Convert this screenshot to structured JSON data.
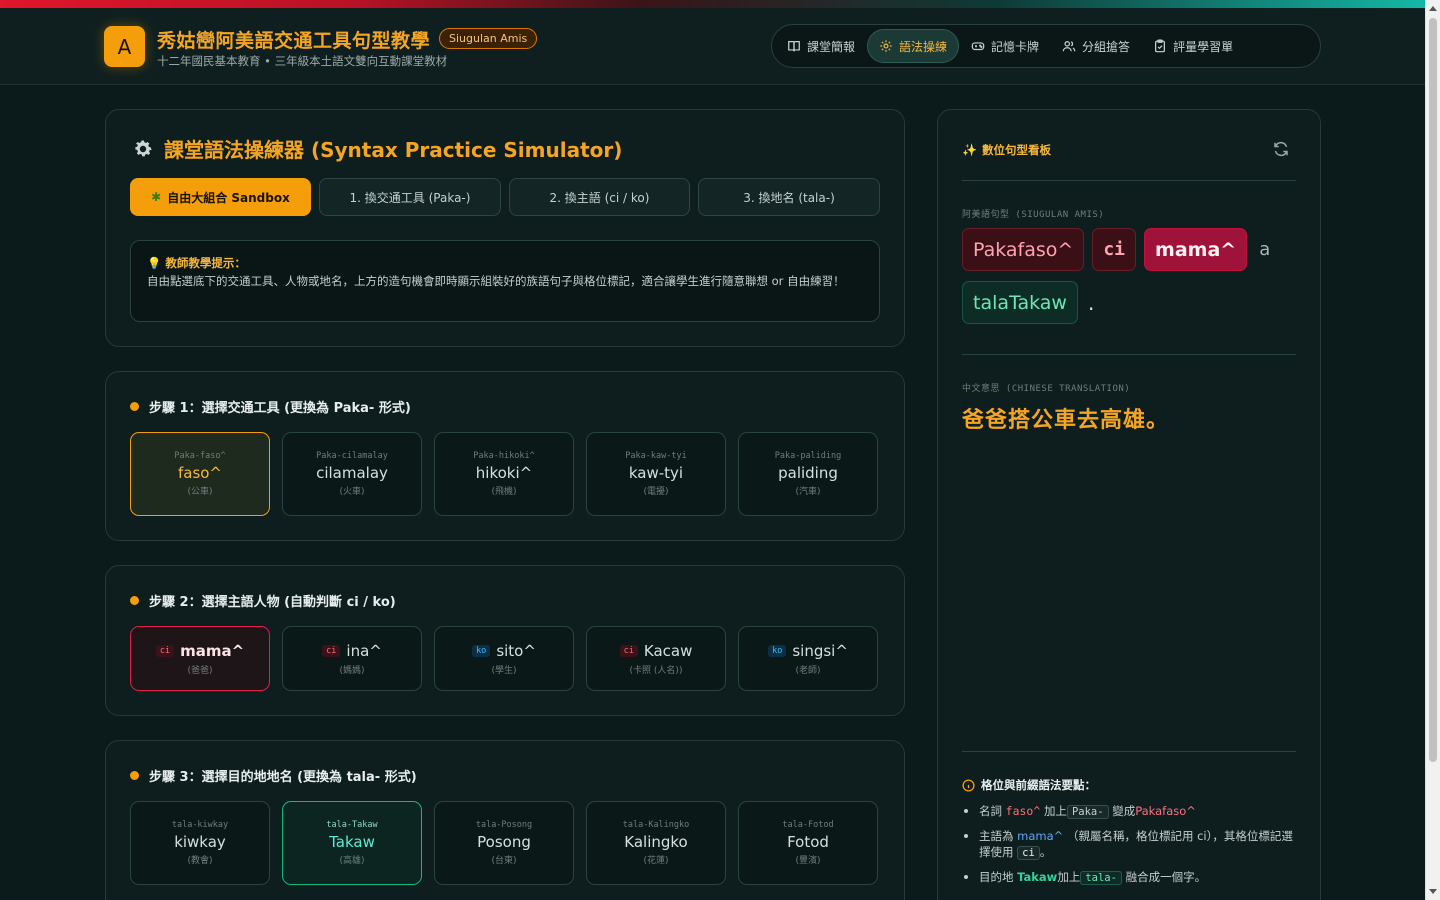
{
  "header": {
    "logo_letter": "A",
    "title": "秀姑巒阿美語交通工具句型教學",
    "badge": "Siugulan Amis",
    "subtitle": "十二年國民基本教育 • 三年級本土語文雙向互動課堂教材"
  },
  "nav": [
    {
      "label": "課堂簡報",
      "icon": "book-icon"
    },
    {
      "label": "語法操練",
      "icon": "gear-icon"
    },
    {
      "label": "記憶卡牌",
      "icon": "gamepad-icon"
    },
    {
      "label": "分組搶答",
      "icon": "users-icon"
    },
    {
      "label": "評量學習單",
      "icon": "clipboard-icon"
    }
  ],
  "nav_active": "語法操練",
  "simulator": {
    "title": "課堂語法操練器 (Syntax Practice Simulator)",
    "tabs": [
      "自由大組合 Sandbox",
      "1. 換交通工具 (Paka-)",
      "2. 換主語 (ci / ko)",
      "3. 換地名 (tala-)"
    ],
    "active_tab": "自由大組合 Sandbox",
    "hint_title": "教師教學提示：",
    "hint_body": "自由點選底下的交通工具、人物或地名，上方的造句機會即時顯示組裝好的族語句子與格位標記，適合讓學生進行隨意聯想 or 自由練習！"
  },
  "step1": {
    "title": "步驟 1：選擇交通工具 (更換為 Paka- 形式)",
    "items": [
      {
        "prefix": "Paka-faso^",
        "word": "faso^",
        "cn": "(公車)"
      },
      {
        "prefix": "Paka-cilamalay",
        "word": "cilamalay",
        "cn": "(火車)"
      },
      {
        "prefix": "Paka-hikoki^",
        "word": "hikoki^",
        "cn": "(飛機)"
      },
      {
        "prefix": "Paka-kaw-tyi",
        "word": "kaw-tyi",
        "cn": "(電擾)"
      },
      {
        "prefix": "Paka-paliding",
        "word": "paliding",
        "cn": "(汽車)"
      }
    ],
    "selected": 0
  },
  "step2": {
    "title": "步驟 2：選擇主語人物 (自動判斷 ci / ko)",
    "items": [
      {
        "marker": "ci",
        "word": "mama^",
        "cn": "(爸爸)"
      },
      {
        "marker": "ci",
        "word": "ina^",
        "cn": "(媽媽)"
      },
      {
        "marker": "ko",
        "word": "sito^",
        "cn": "(學生)"
      },
      {
        "marker": "ci",
        "word": "Kacaw",
        "cn": "(卡照 (人名))"
      },
      {
        "marker": "ko",
        "word": "singsi^",
        "cn": "(老師)"
      }
    ],
    "selected": 0
  },
  "step3": {
    "title": "步驟 3：選擇目的地地名 (更換為 tala- 形式)",
    "items": [
      {
        "prefix": "tala-kiwkay",
        "word": "kiwkay",
        "cn": "(教會)"
      },
      {
        "prefix": "tala-Takaw",
        "word": "Takaw",
        "cn": "(高雄)"
      },
      {
        "prefix": "tala-Posong",
        "word": "Posong",
        "cn": "(台東)"
      },
      {
        "prefix": "tala-Kalingko",
        "word": "Kalingko",
        "cn": "(花蓮)"
      },
      {
        "prefix": "tala-Fotod",
        "word": "Fotod",
        "cn": "(豐濱)"
      }
    ],
    "selected": 1
  },
  "board": {
    "title": "數位句型看板",
    "amis_label": "阿美語句型 (SIUGULAN AMIS)",
    "sentence": {
      "w1": "Pakafaso^",
      "w2": "ci",
      "w3": "mama^",
      "w4": "a",
      "w5": "talaTakaw",
      "w6": "."
    },
    "cn_label": "中文意思 (CHINESE TRANSLATION)",
    "translation": "爸爸搭公車去高雄。",
    "grammar_title": "格位與前綴語法要點：",
    "g1": {
      "a": "名詞",
      "b": "faso^",
      "c": "加上",
      "d": "Paka-",
      "e": "變成",
      "f": "Pakafaso^"
    },
    "g2": {
      "a": "主語為",
      "b": "mama^",
      "c": "（親屬名稱，格位標記用 ci），其格位標記選擇使用",
      "d": "ci",
      "e": "。"
    },
    "g3": {
      "a": "目的地",
      "b": "Takaw",
      "c": "加上",
      "d": "tala-",
      "e": "融合成一個字。"
    }
  }
}
